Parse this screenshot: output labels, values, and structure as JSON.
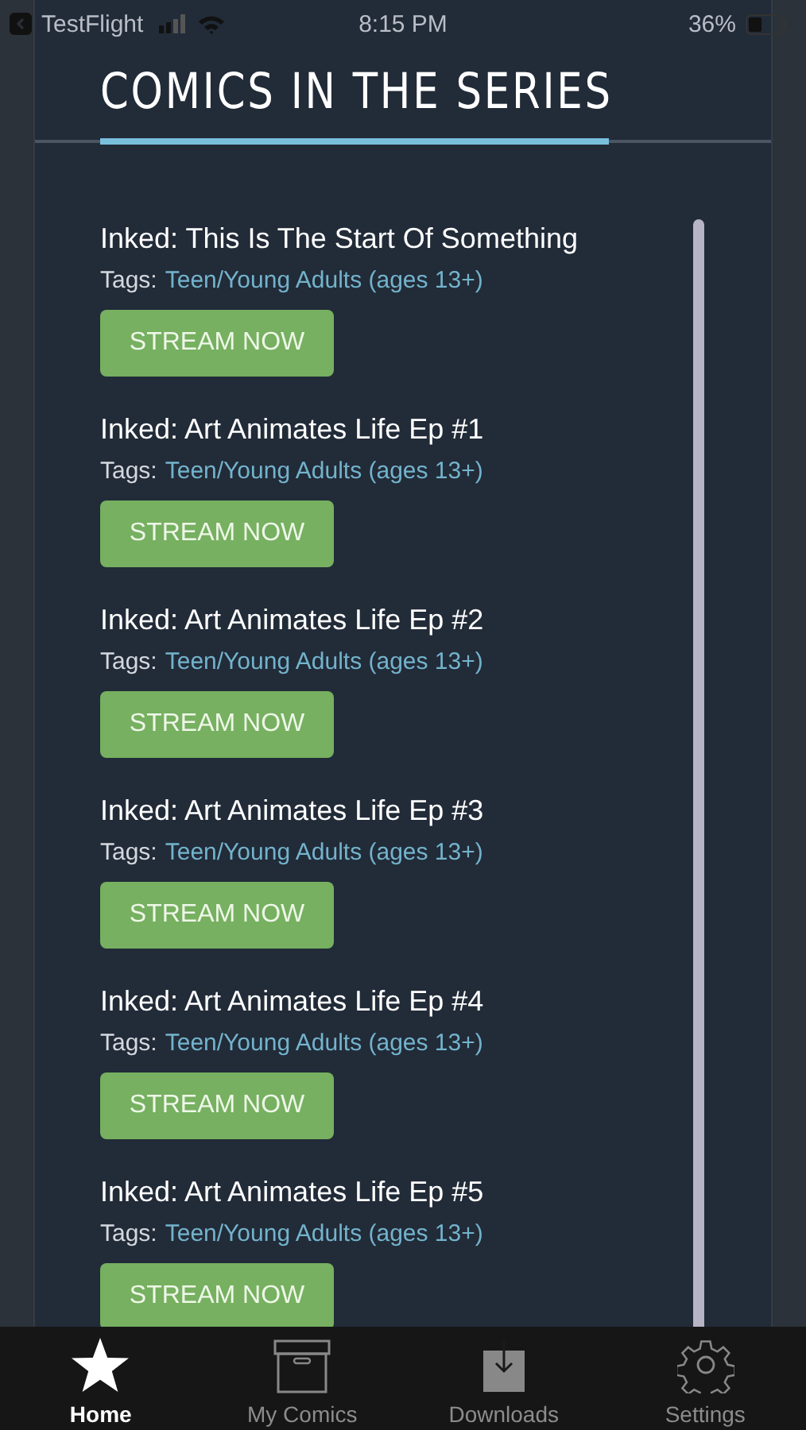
{
  "status_bar": {
    "back_app": "TestFlight",
    "time": "8:15 PM",
    "battery": "36%"
  },
  "section_title": "COMICS IN THE SERIES",
  "comics": [
    {
      "title": "Inked: This Is The Start Of Something",
      "tags_label": "Tags:",
      "tag": "Teen/Young Adults (ages 13+)",
      "button": "STREAM NOW"
    },
    {
      "title": "Inked: Art Animates Life Ep #1",
      "tags_label": "Tags:",
      "tag": "Teen/Young Adults (ages 13+)",
      "button": "STREAM NOW"
    },
    {
      "title": "Inked: Art Animates Life Ep #2",
      "tags_label": "Tags:",
      "tag": "Teen/Young Adults (ages 13+)",
      "button": "STREAM NOW"
    },
    {
      "title": "Inked: Art Animates Life Ep #3",
      "tags_label": "Tags:",
      "tag": "Teen/Young Adults (ages 13+)",
      "button": "STREAM NOW"
    },
    {
      "title": "Inked: Art Animates Life Ep #4",
      "tags_label": "Tags:",
      "tag": "Teen/Young Adults (ages 13+)",
      "button": "STREAM NOW"
    },
    {
      "title": "Inked: Art Animates Life Ep #5",
      "tags_label": "Tags:",
      "tag": "Teen/Young Adults (ages 13+)",
      "button": "STREAM NOW"
    }
  ],
  "tab_bar": [
    {
      "label": "Home",
      "kind": "star",
      "selected": true
    },
    {
      "label": "My Comics",
      "kind": "box",
      "selected": false
    },
    {
      "label": "Downloads",
      "kind": "download",
      "selected": false
    },
    {
      "label": "Settings",
      "kind": "gear",
      "selected": false
    }
  ]
}
